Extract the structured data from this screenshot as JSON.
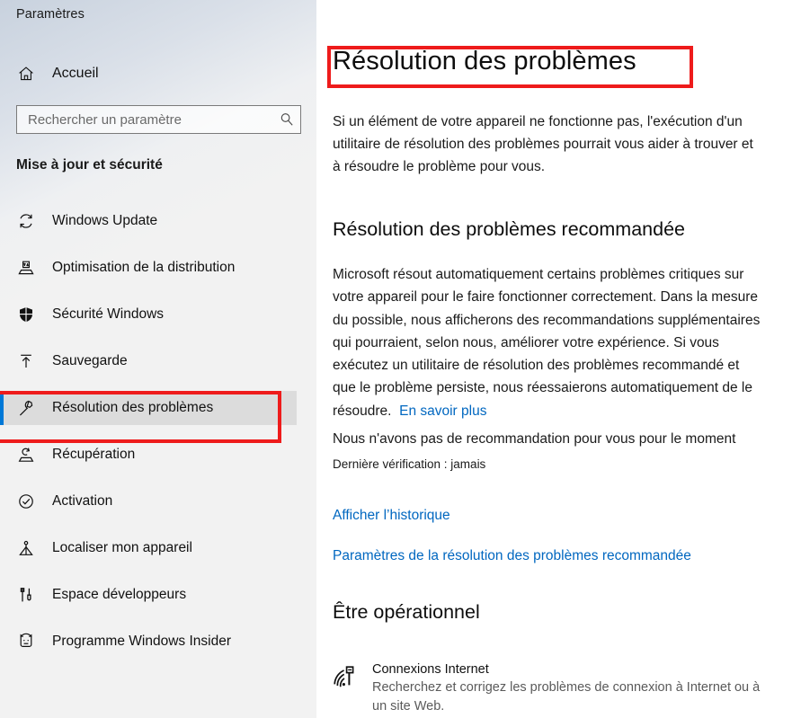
{
  "sidebar": {
    "app_title": "Paramètres",
    "home": {
      "label": "Accueil",
      "icon": "home-icon"
    },
    "search": {
      "placeholder": "Rechercher un paramètre",
      "value": "",
      "icon": "search-icon"
    },
    "group_title": "Mise à jour et sécurité",
    "items": [
      {
        "label": "Windows Update",
        "icon": "refresh-icon",
        "selected": false
      },
      {
        "label": "Optimisation de la distribution",
        "icon": "delivery-optimization-icon",
        "selected": false
      },
      {
        "label": "Sécurité Windows",
        "icon": "shield-icon",
        "selected": false
      },
      {
        "label": "Sauvegarde",
        "icon": "upload-arrow-icon",
        "selected": false
      },
      {
        "label": "Résolution des problèmes",
        "icon": "wrench-icon",
        "selected": true
      },
      {
        "label": "Récupération",
        "icon": "recovery-icon",
        "selected": false
      },
      {
        "label": "Activation",
        "icon": "check-circle-icon",
        "selected": false
      },
      {
        "label": "Localiser mon appareil",
        "icon": "locate-device-icon",
        "selected": false
      },
      {
        "label": "Espace développeurs",
        "icon": "developer-tools-icon",
        "selected": false
      },
      {
        "label": "Programme Windows Insider",
        "icon": "insider-cat-icon",
        "selected": false
      }
    ]
  },
  "main": {
    "page_title": "Résolution des problèmes",
    "intro": "Si un élément de votre appareil ne fonctionne pas, l'exécution d'un utilitaire de résolution des problèmes pourrait vous aider à trouver et à résoudre le problème pour vous.",
    "recommended": {
      "heading": "Résolution des problèmes recommandée",
      "body": "Microsoft résout automatiquement certains problèmes critiques sur votre appareil pour le faire fonctionner correctement. Dans la mesure du possible, nous afficherons des recommandations supplémentaires qui pourraient, selon nous, améliorer votre expérience. Si vous exécutez un utilitaire de résolution des problèmes recommandé et que le problème persiste, nous réessaierons automatiquement de le résoudre.",
      "learn_more": "En savoir plus",
      "status": "Nous n'avons pas de recommandation pour vous pour le moment",
      "last_check": "Dernière vérification : jamais",
      "link_history": "Afficher l’historique",
      "link_settings": "Paramètres de la résolution des problèmes recommandée"
    },
    "get_up_running": {
      "heading": "Être opérationnel",
      "items": [
        {
          "title": "Connexions Internet",
          "description": "Recherchez et corrigez les problèmes de connexion à Internet ou à un site Web.",
          "icon": "wifi-network-icon"
        }
      ]
    }
  },
  "annotations": {
    "color": "#ee1b1b",
    "boxes": [
      {
        "name": "title-highlight"
      },
      {
        "name": "sidebar-selected-highlight"
      }
    ]
  },
  "theme": {
    "accent": "#0078d7",
    "link": "#0067c0",
    "selected_bg": "#dcdcdc",
    "sidebar_bg": "#f2f2f2"
  }
}
